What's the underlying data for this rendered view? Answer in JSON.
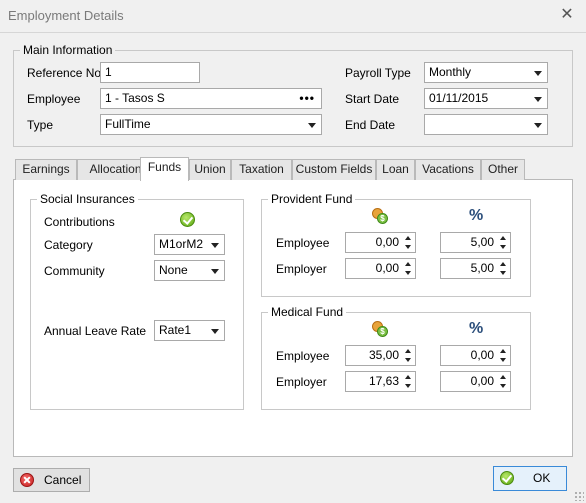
{
  "window": {
    "title": "Employment Details",
    "close_glyph": "✕"
  },
  "main_info": {
    "legend": "Main Information",
    "reference_no": {
      "label": "Reference No",
      "value": "1"
    },
    "employee": {
      "label": "Employee",
      "value": "1 - Tasos S",
      "button": "•••"
    },
    "type": {
      "label": "Type",
      "value": "FullTime"
    },
    "payroll_type": {
      "label": "Payroll Type",
      "value": "Monthly"
    },
    "start_date": {
      "label": "Start Date",
      "value": "01/11/2015"
    },
    "end_date": {
      "label": "End Date",
      "value": ""
    }
  },
  "tabs": [
    {
      "label": "Earnings"
    },
    {
      "label": "Allocation"
    },
    {
      "label": "Funds",
      "active": true
    },
    {
      "label": "Union"
    },
    {
      "label": "Taxation"
    },
    {
      "label": "Custom Fields"
    },
    {
      "label": "Loan"
    },
    {
      "label": "Vacations"
    },
    {
      "label": "Other"
    }
  ],
  "social": {
    "legend": "Social Insurances",
    "contributions_label": "Contributions",
    "contributions_icon": "check-circle-icon",
    "category": {
      "label": "Category",
      "value": "M1orM2"
    },
    "community": {
      "label": "Community",
      "value": "None"
    },
    "annual_leave": {
      "label": "Annual Leave Rate",
      "value": "Rate1"
    }
  },
  "provident": {
    "legend": "Provident Fund",
    "amount_icon": "coins-icon",
    "percent_symbol": "%",
    "employee": {
      "label": "Employee",
      "amount": "0,00",
      "percent": "5,00"
    },
    "employer": {
      "label": "Employer",
      "amount": "0,00",
      "percent": "5,00"
    }
  },
  "medical": {
    "legend": "Medical Fund",
    "amount_icon": "coins-icon",
    "percent_symbol": "%",
    "employee": {
      "label": "Employee",
      "amount": "35,00",
      "percent": "0,00"
    },
    "employer": {
      "label": "Employer",
      "amount": "17,63",
      "percent": "0,00"
    }
  },
  "buttons": {
    "cancel": "Cancel",
    "ok": "OK"
  },
  "colors": {
    "accent": "#3a8ad8",
    "check_green": "#5aa70f",
    "cancel_red": "#c81e1e"
  }
}
